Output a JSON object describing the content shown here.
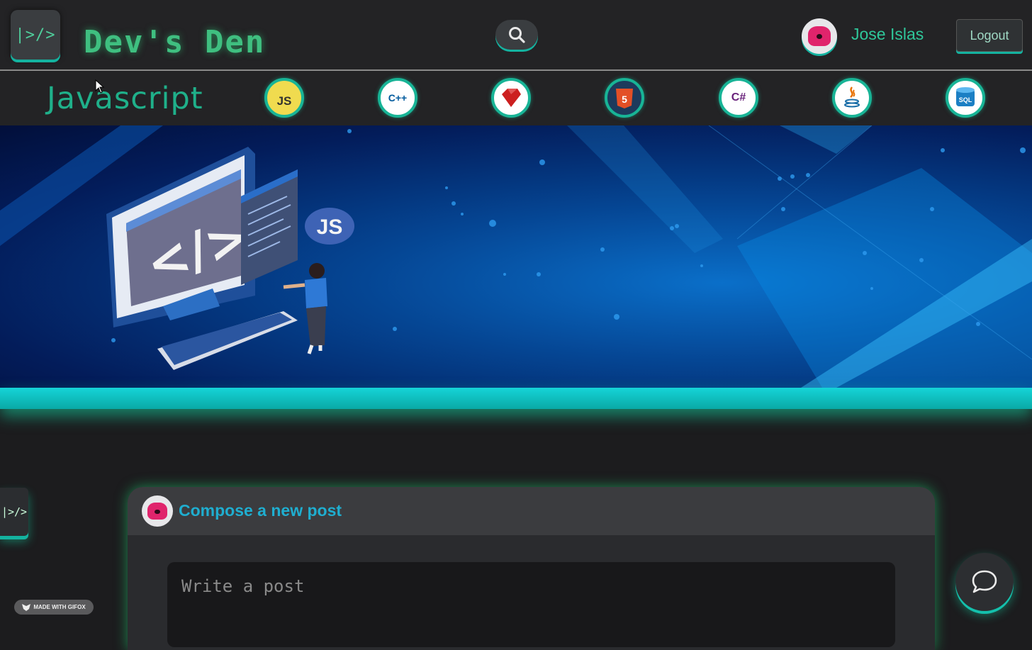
{
  "header": {
    "logo_glyph": "|>/>",
    "brand_text": "Dev's Den",
    "search_icon": "search-icon",
    "user_name": "Jose Islas",
    "logout_label": "Logout"
  },
  "lang_bar": {
    "title": "Javascript",
    "items": [
      {
        "name": "javascript",
        "label": "JS",
        "bg": "#f0db4f",
        "fg": "#323330"
      },
      {
        "name": "cplusplus",
        "label": "C++",
        "bg": "#ffffff",
        "fg": "#00599c"
      },
      {
        "name": "ruby",
        "label": "",
        "bg": "#ffffff",
        "fg": "#cc1f1f"
      },
      {
        "name": "html5",
        "label": "5",
        "bg": "#1d3a5c",
        "fg": "#e34f26"
      },
      {
        "name": "csharp",
        "label": "C#",
        "bg": "#ffffff",
        "fg": "#68217a"
      },
      {
        "name": "java",
        "label": "",
        "bg": "#ffffff",
        "fg": "#e76f00"
      },
      {
        "name": "sql",
        "label": "SQL",
        "bg": "#ffffff",
        "fg": "#1b7fc4"
      }
    ]
  },
  "banner": {
    "badge_label": "JS"
  },
  "side_tab": {
    "glyph": "|>/>"
  },
  "compose": {
    "title": "Compose a new post",
    "placeholder": "Write a post"
  },
  "gifox": {
    "label": "MADE WITH GIFOX"
  },
  "colors": {
    "accent": "#14b3a0",
    "brand_green": "#3fbf80",
    "compose_title": "#1faed0"
  }
}
